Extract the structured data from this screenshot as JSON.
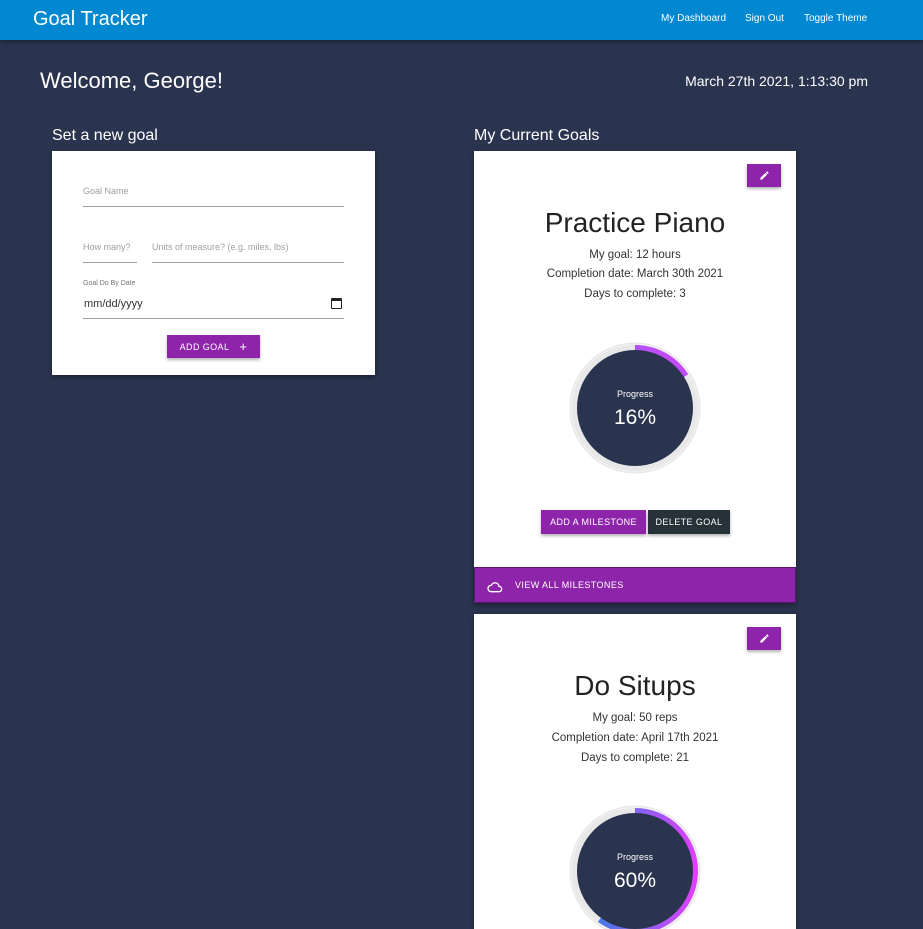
{
  "navbar": {
    "brand": "Goal Tracker",
    "links": [
      "My Dashboard",
      "Sign Out",
      "Toggle Theme"
    ]
  },
  "header": {
    "welcome": "Welcome, George!",
    "datetime": "March 27th 2021, 1:13:30 pm"
  },
  "new_goal": {
    "section_title": "Set a new goal",
    "goal_name_placeholder": "Goal Name",
    "how_many_placeholder": "How many?",
    "units_placeholder": "Units of measure? (e.g. miles, lbs)",
    "date_label": "Goal Do By Date",
    "date_value": "mm/dd/yyyy",
    "add_button": "ADD GOAL",
    "add_icon": "+"
  },
  "current_goals": {
    "section_title": "My Current Goals",
    "goals": [
      {
        "title": "Practice Piano",
        "goal_line": "My goal: 12 hours",
        "completion_line": "Completion date: March 30th 2021",
        "days_line": "Days to complete: 3",
        "progress_label": "Progress",
        "progress_text": "16%",
        "progress": 0.16,
        "add_milestone": "ADD A MILESTONE",
        "delete_goal": "DELETE GOAL",
        "view_milestones": "VIEW ALL MILESTONES"
      },
      {
        "title": "Do Situps",
        "goal_line": "My goal: 50 reps",
        "completion_line": "Completion date: April 17th 2021",
        "days_line": "Days to complete: 21",
        "progress_label": "Progress",
        "progress_text": "60%",
        "progress": 0.6
      }
    ]
  },
  "colors": {
    "background": "#2b344f",
    "navbar": "#0288d1",
    "accent": "#8e24aa",
    "dark_button": "#263238",
    "progress_start": "#1e88e5",
    "progress_end": "#e040fb"
  }
}
